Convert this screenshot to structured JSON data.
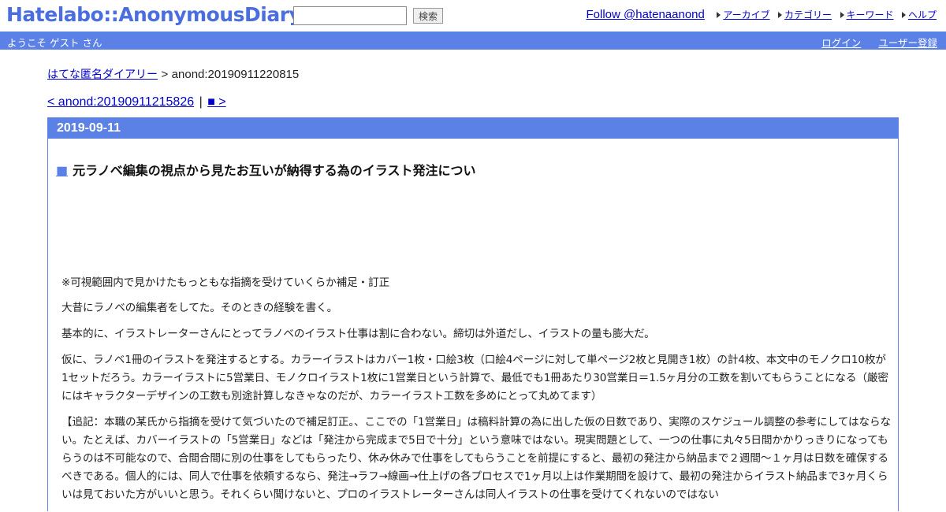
{
  "header": {
    "logo": "Hatelabo::AnonymousDiary",
    "search": {
      "value": "",
      "button": "検索"
    },
    "follow": "Follow @hatenaanond",
    "links": [
      "アーカイブ",
      "カテゴリー",
      "キーワード",
      "ヘルプ"
    ]
  },
  "bar": {
    "welcome": "ようこそ ゲスト さん",
    "login": "ログイン",
    "register": "ユーザー登録"
  },
  "breadcrumb": {
    "root": "はてな匿名ダイアリー",
    "separator": ">",
    "current": "anond:20190911220815"
  },
  "pager": {
    "prev": "< anond:20190911215826",
    "separator": "|",
    "next": "■ >"
  },
  "day": {
    "date": "2019-09-11",
    "title_mark": "■",
    "title": "元ラノベ編集の視点から見たお互いが納得する為のイラスト発注につい"
  },
  "body": {
    "paragraphs": [
      "※可視範囲内で見かけたもっともな指摘を受けていくらか補足・訂正",
      "大昔にラノベの編集者をしてた。そのときの経験を書く。",
      "基本的に、イラストレーターさんにとってラノベのイラスト仕事は割に合わない。締切は外道だし、イラストの量も膨大だ。",
      "仮に、ラノベ1冊のイラストを発注するとする。カラーイラストはカバー1枚・口絵3枚（口絵4ページに対して単ページ2枚と見開き1枚）の計4枚、本文中のモノクロ10枚が1セットだろう。カラーイラストに5営業日、モノクロイラスト1枚に1営業日という計算で、最低でも1冊あたり30営業日＝1.5ヶ月分の工数を割いてもらうことになる（厳密にはキャラクターデザインの工数も別途計算しなきゃなのだが、カラーイラスト工数を多めにとって丸めてます）",
      "【追記：本職の某氏から指摘を受けて気づいたので補足訂正。、ここでの「1営業日」は稿料計算の為に出した仮の日数であり、実際のスケジュール調整の参考にしてはならない。たとえば、カバーイラストの「5営業日」などは「発注から完成まで5日で十分」という意味ではない。現実問題として、一つの仕事に丸々5日間かかりっきりになってもらうのは不可能なので、合間合間に別の仕事をしてもらったり、休み休みで仕事をしてもらうことを前提にすると、最初の発注から納品まで２週間〜１ヶ月は日数を確保するべきである。個人的には、同人で仕事を依頼するなら、発注→ラフ→線画→仕上げの各プロセスで1ヶ月以上は作業期間を設けて、最初の発注からイラスト納品まで3ヶ月くらいは見ておいた方がいいと思う。それくらい聞けないと、プロのイラストレーターさんは同人イラストの仕事を受けてくれないのではない"
    ]
  }
}
